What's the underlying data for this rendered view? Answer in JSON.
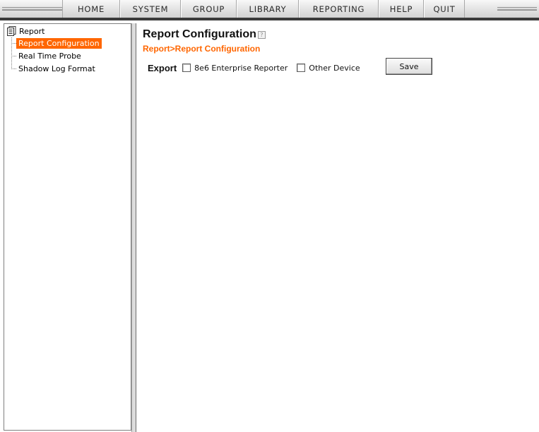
{
  "menu": {
    "items": [
      {
        "label": "HOME"
      },
      {
        "label": "SYSTEM"
      },
      {
        "label": "GROUP"
      },
      {
        "label": "LIBRARY"
      },
      {
        "label": "REPORTING"
      },
      {
        "label": "HELP"
      },
      {
        "label": "QUIT"
      }
    ]
  },
  "tree": {
    "root": {
      "label": "Report",
      "icon": "document-icon"
    },
    "children": [
      {
        "label": "Report Configuration",
        "selected": true
      },
      {
        "label": "Real Time Probe",
        "selected": false
      },
      {
        "label": "Shadow Log Format",
        "selected": false
      }
    ]
  },
  "content": {
    "title": "Report Configuration",
    "help_icon": "?",
    "breadcrumb": "Report>Report Configuration",
    "export": {
      "label": "Export",
      "options": [
        {
          "label": "8e6 Enterprise Reporter",
          "checked": false
        },
        {
          "label": "Other Device",
          "checked": false
        }
      ]
    },
    "save_label": "Save"
  },
  "colors": {
    "accent": "#ff6600",
    "menubar_border": "#3a3a3a"
  }
}
